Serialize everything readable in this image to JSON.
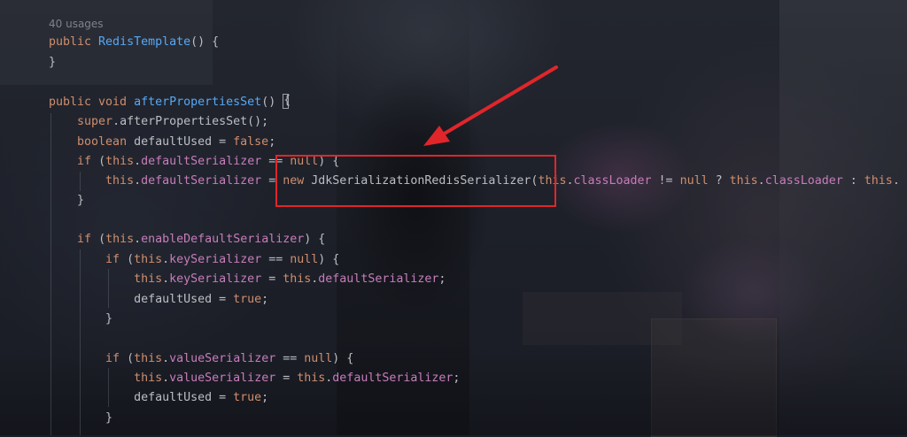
{
  "editor": {
    "usages_hint": "40 usages",
    "lines": [
      [
        {
          "t": "public ",
          "c": "kw"
        },
        {
          "t": "RedisTemplate",
          "c": "fn"
        },
        {
          "t": "() {",
          "c": "pl"
        }
      ],
      [
        {
          "t": "}",
          "c": "pl"
        }
      ],
      [
        {
          "t": "public void ",
          "c": "kw"
        },
        {
          "t": "afterPropertiesSet",
          "c": "fn"
        },
        {
          "t": "() ",
          "c": "pl"
        }
      ],
      [
        {
          "t": "    ",
          "c": "pl"
        },
        {
          "t": "super",
          "c": "kw"
        },
        {
          "t": ".afterPropertiesSet();",
          "c": "pl"
        }
      ],
      [
        {
          "t": "    ",
          "c": "pl"
        },
        {
          "t": "boolean ",
          "c": "kw"
        },
        {
          "t": "defaultUsed = ",
          "c": "pl"
        },
        {
          "t": "false",
          "c": "kw"
        },
        {
          "t": ";",
          "c": "pl"
        }
      ],
      [
        {
          "t": "    ",
          "c": "pl"
        },
        {
          "t": "if ",
          "c": "kw"
        },
        {
          "t": "(",
          "c": "pl"
        },
        {
          "t": "this",
          "c": "kw"
        },
        {
          "t": ".",
          "c": "pl"
        },
        {
          "t": "defaultSerializer",
          "c": "fld"
        },
        {
          "t": " == ",
          "c": "pl"
        },
        {
          "t": "null",
          "c": "kw"
        },
        {
          "t": ") {",
          "c": "pl"
        }
      ],
      [
        {
          "t": "        ",
          "c": "pl"
        },
        {
          "t": "this",
          "c": "kw"
        },
        {
          "t": ".",
          "c": "pl"
        },
        {
          "t": "defaultSerializer",
          "c": "fld"
        },
        {
          "t": " = ",
          "c": "pl"
        },
        {
          "t": "new ",
          "c": "kw"
        },
        {
          "t": "JdkSerializationRedisSerializer(",
          "c": "pl"
        },
        {
          "t": "this",
          "c": "kw"
        },
        {
          "t": ".",
          "c": "pl"
        },
        {
          "t": "classLoader",
          "c": "fld"
        },
        {
          "t": " != ",
          "c": "pl"
        },
        {
          "t": "null",
          "c": "kw"
        },
        {
          "t": " ? ",
          "c": "pl"
        },
        {
          "t": "this",
          "c": "kw"
        },
        {
          "t": ".",
          "c": "pl"
        },
        {
          "t": "classLoader",
          "c": "fld"
        },
        {
          "t": " : ",
          "c": "pl"
        },
        {
          "t": "this",
          "c": "kw"
        },
        {
          "t": ".",
          "c": "pl"
        }
      ],
      [
        {
          "t": "    }",
          "c": "pl"
        }
      ],
      [
        {
          "t": "    ",
          "c": "pl"
        },
        {
          "t": "if ",
          "c": "kw"
        },
        {
          "t": "(",
          "c": "pl"
        },
        {
          "t": "this",
          "c": "kw"
        },
        {
          "t": ".",
          "c": "pl"
        },
        {
          "t": "enableDefaultSerializer",
          "c": "fld"
        },
        {
          "t": ") {",
          "c": "pl"
        }
      ],
      [
        {
          "t": "        ",
          "c": "pl"
        },
        {
          "t": "if ",
          "c": "kw"
        },
        {
          "t": "(",
          "c": "pl"
        },
        {
          "t": "this",
          "c": "kw"
        },
        {
          "t": ".",
          "c": "pl"
        },
        {
          "t": "keySerializer",
          "c": "fld"
        },
        {
          "t": " == ",
          "c": "pl"
        },
        {
          "t": "null",
          "c": "kw"
        },
        {
          "t": ") {",
          "c": "pl"
        }
      ],
      [
        {
          "t": "            ",
          "c": "pl"
        },
        {
          "t": "this",
          "c": "kw"
        },
        {
          "t": ".",
          "c": "pl"
        },
        {
          "t": "keySerializer",
          "c": "fld"
        },
        {
          "t": " = ",
          "c": "pl"
        },
        {
          "t": "this",
          "c": "kw"
        },
        {
          "t": ".",
          "c": "pl"
        },
        {
          "t": "defaultSerializer",
          "c": "fld"
        },
        {
          "t": ";",
          "c": "pl"
        }
      ],
      [
        {
          "t": "            defaultUsed = ",
          "c": "pl"
        },
        {
          "t": "true",
          "c": "kw"
        },
        {
          "t": ";",
          "c": "pl"
        }
      ],
      [
        {
          "t": "        }",
          "c": "pl"
        }
      ],
      [
        {
          "t": "        ",
          "c": "pl"
        },
        {
          "t": "if ",
          "c": "kw"
        },
        {
          "t": "(",
          "c": "pl"
        },
        {
          "t": "this",
          "c": "kw"
        },
        {
          "t": ".",
          "c": "pl"
        },
        {
          "t": "valueSerializer",
          "c": "fld"
        },
        {
          "t": " == ",
          "c": "pl"
        },
        {
          "t": "null",
          "c": "kw"
        },
        {
          "t": ") {",
          "c": "pl"
        }
      ],
      [
        {
          "t": "            ",
          "c": "pl"
        },
        {
          "t": "this",
          "c": "kw"
        },
        {
          "t": ".",
          "c": "pl"
        },
        {
          "t": "valueSerializer",
          "c": "fld"
        },
        {
          "t": " = ",
          "c": "pl"
        },
        {
          "t": "this",
          "c": "kw"
        },
        {
          "t": ".",
          "c": "pl"
        },
        {
          "t": "defaultSerializer",
          "c": "fld"
        },
        {
          "t": ";",
          "c": "pl"
        }
      ],
      [
        {
          "t": "            defaultUsed = ",
          "c": "pl"
        },
        {
          "t": "true",
          "c": "kw"
        },
        {
          "t": ";",
          "c": "pl"
        }
      ],
      [
        {
          "t": "        }",
          "c": "pl"
        }
      ]
    ],
    "caret_brace": "{"
  },
  "colors": {
    "keyword": "#cf8e6d",
    "method": "#56a8f5",
    "field": "#c77dbb",
    "plain": "#bcbec4",
    "annotation_red": "#e0262a"
  },
  "icons": {
    "caret": "text-caret-icon",
    "arrow": "red-pointer-arrow-icon"
  }
}
